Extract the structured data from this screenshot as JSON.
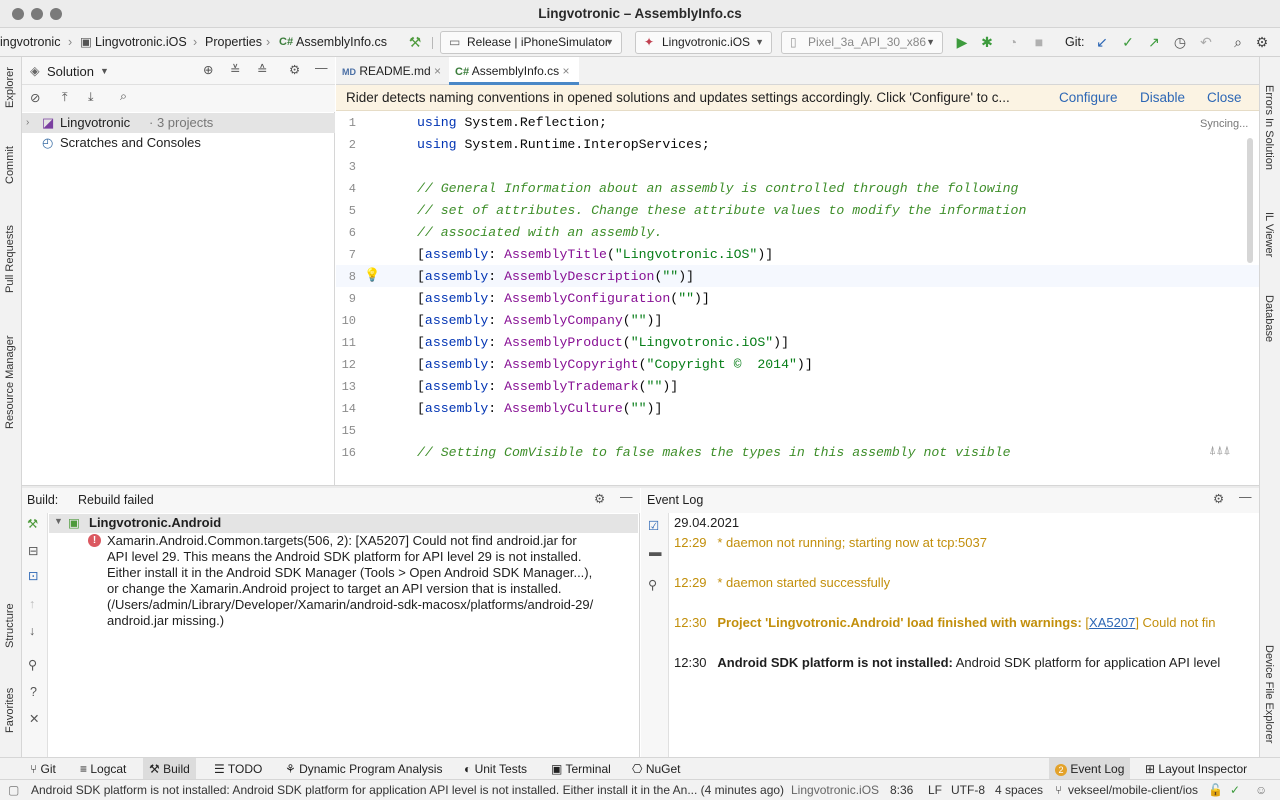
{
  "window": {
    "title": "Lingvotronic – AssemblyInfo.cs"
  },
  "navbar": {
    "breadcrumb": [
      "ingvotronic",
      "Lingvotronic.iOS",
      "Properties",
      "AssemblyInfo.cs"
    ],
    "cs_prefix": "C#",
    "config_combo": "Release | iPhoneSimulator",
    "project_combo": "Lingvotronic.iOS",
    "device_combo": "Pixel_3a_API_30_x86",
    "git_label": "Git:"
  },
  "left_strip": [
    "Explorer",
    "Commit",
    "Pull Requests",
    "Resource Manager",
    "Structure",
    "Favorites"
  ],
  "right_strip": [
    "Errors In Solution",
    "IL Viewer",
    "Database",
    "Device File Explorer"
  ],
  "solution": {
    "header": "Solution",
    "tree": [
      {
        "name": "Lingvotronic",
        "suffix": "· 3 projects"
      },
      {
        "name": "Scratches and Consoles",
        "suffix": ""
      }
    ]
  },
  "editor": {
    "tabs": [
      {
        "label": "README.md",
        "prefix": "MD"
      },
      {
        "label": "AssemblyInfo.cs",
        "prefix": "C#"
      }
    ],
    "notification": {
      "text": "Rider detects naming conventions in opened solutions and updates settings accordingly. Click 'Configure' to c...",
      "actions": [
        "Configure",
        "Disable",
        "Close"
      ]
    },
    "syncing": "Syncing...",
    "line_numbers": [
      "1",
      "2",
      "3",
      "4",
      "5",
      "6",
      "7",
      "8",
      "9",
      "10",
      "11",
      "12",
      "13",
      "14",
      "15",
      "16"
    ],
    "lines": [
      {
        "kind": "using",
        "ns": "System.Reflection"
      },
      {
        "kind": "using",
        "ns": "System.Runtime.InteropServices"
      },
      {
        "kind": "blank"
      },
      {
        "kind": "comment",
        "text": "// General Information about an assembly is controlled through the following"
      },
      {
        "kind": "comment",
        "text": "// set of attributes. Change these attribute values to modify the information"
      },
      {
        "kind": "comment",
        "text": "// associated with an assembly."
      },
      {
        "kind": "attr",
        "name": "AssemblyTitle",
        "value": "\"Lingvotronic.iOS\""
      },
      {
        "kind": "attr",
        "name": "AssemblyDescription",
        "value": "\"\""
      },
      {
        "kind": "attr",
        "name": "AssemblyConfiguration",
        "value": "\"\""
      },
      {
        "kind": "attr",
        "name": "AssemblyCompany",
        "value": "\"\""
      },
      {
        "kind": "attr",
        "name": "AssemblyProduct",
        "value": "\"Lingvotronic.iOS\""
      },
      {
        "kind": "attr",
        "name": "AssemblyCopyright",
        "value": "\"Copyright ©  2014\""
      },
      {
        "kind": "attr",
        "name": "AssemblyTrademark",
        "value": "\"\""
      },
      {
        "kind": "attr",
        "name": "AssemblyCulture",
        "value": "\"\""
      },
      {
        "kind": "blank"
      },
      {
        "kind": "comment",
        "text": "// Setting ComVisible to false makes the types in this assembly not visible"
      }
    ],
    "keywords": {
      "using": "using",
      "assembly": "assembly"
    }
  },
  "build": {
    "label": "Build:",
    "status": "Rebuild failed",
    "project": "Lingvotronic.Android",
    "message_lines": [
      "Xamarin.Android.Common.targets(506, 2): [XA5207] Could not find android.jar for",
      "API level 29. This means the Android SDK platform for API level 29 is not installed.",
      "Either install it in the Android SDK Manager (Tools > Open Android SDK Manager...),",
      "or change the Xamarin.Android project to target an API version that is installed.",
      "(/Users/admin/Library/Developer/Xamarin/android-sdk-macosx/platforms/android-29/",
      "android.jar missing.)"
    ]
  },
  "event_log": {
    "title": "Event Log",
    "date": "29.04.2021",
    "entries": [
      {
        "time": "12:29",
        "bold": "",
        "text": "* daemon not running; starting now at tcp:5037",
        "link": "",
        "after": ""
      },
      {
        "time": "12:29",
        "bold": "",
        "text": "* daemon started successfully",
        "link": "",
        "after": ""
      },
      {
        "time": "12:30",
        "bold": "Project 'Lingvotronic.Android' load finished with warnings:",
        "text": "",
        "link": "XA5207",
        "after": "] Could not fin"
      },
      {
        "time": "12:30",
        "bold": "Android SDK platform is not installed:",
        "text": " Android SDK platform for application API level",
        "link": "",
        "after": ""
      }
    ]
  },
  "bottom_tabs": [
    "Git",
    "Logcat",
    "Build",
    "TODO",
    "Dynamic Program Analysis",
    "Unit Tests",
    "Terminal",
    "NuGet"
  ],
  "bottom_right_tabs": {
    "event_log": "Event Log",
    "event_count": "2",
    "layout_inspector": "Layout Inspector"
  },
  "status_bar": {
    "message": "Android SDK platform is not installed: Android SDK platform for application API level is not installed. Either install it in the An... (4 minutes ago)",
    "project": "Lingvotronic.iOS",
    "position": "8:36",
    "line_sep": "LF",
    "encoding": "UTF-8",
    "indent": "4 spaces",
    "branch": "vekseel/mobile-client/ios"
  }
}
